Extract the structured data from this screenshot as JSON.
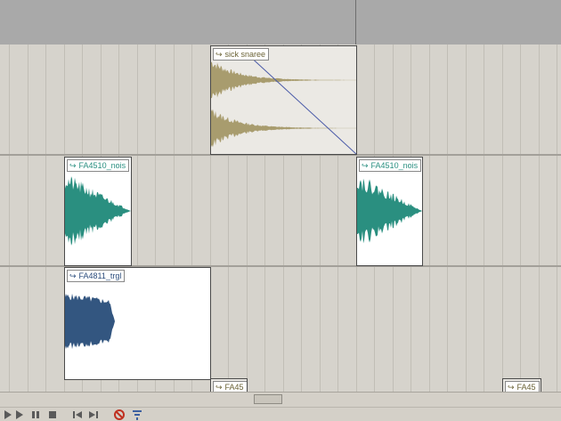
{
  "arrange": {
    "clips": [
      {
        "id": "snare",
        "label": "sick snaree",
        "arrow": "↪"
      },
      {
        "id": "nois1",
        "label": "FA4510_nois",
        "arrow": "↪"
      },
      {
        "id": "nois2",
        "label": "FA4510_nois",
        "arrow": "↪"
      },
      {
        "id": "trgl",
        "label": "FA4811_trgl",
        "arrow": "↪"
      },
      {
        "id": "fa45a",
        "label": "FA45",
        "arrow": "↪"
      },
      {
        "id": "fa45b",
        "label": "FA45",
        "arrow": "↪"
      }
    ]
  },
  "colors": {
    "snare_wave": "#a89c6e",
    "nois_wave": "#2a8f80",
    "trgl_wave": "#335680",
    "fade_line": "#4a5aa8",
    "record": "#c03020"
  },
  "transport": {
    "icons": [
      "play-icon",
      "play-icon",
      "pause-icon",
      "stop-icon",
      "rewind-start-icon",
      "forward-end-icon",
      "record-disabled-icon",
      "settings-icon"
    ]
  }
}
